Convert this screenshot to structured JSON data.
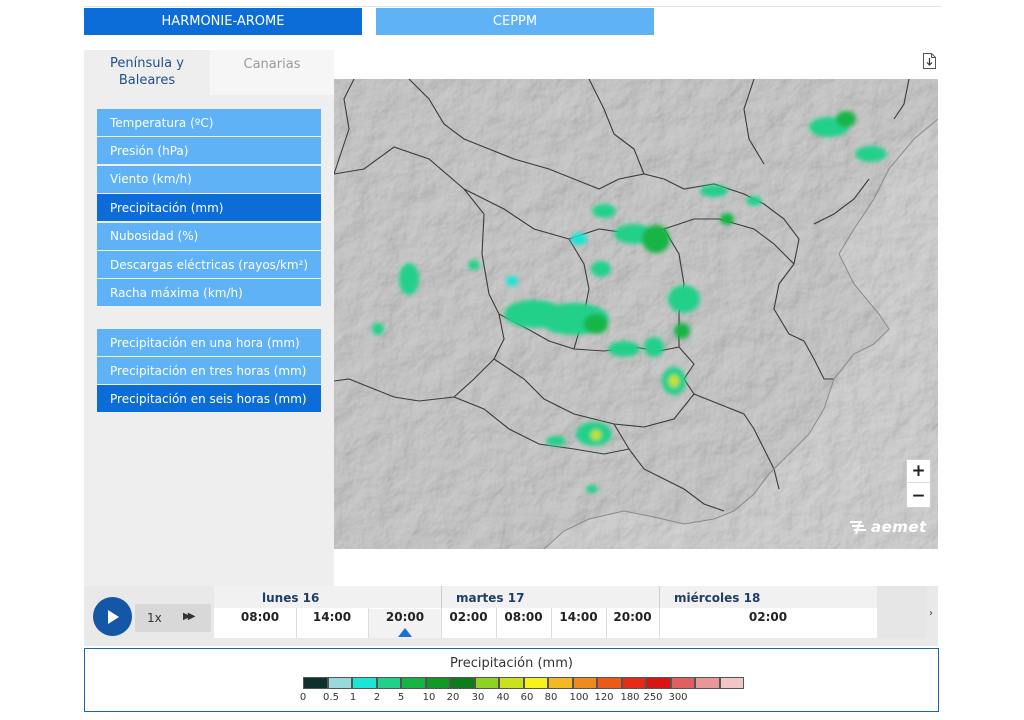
{
  "models": {
    "harmonie": "HARMONIE-AROME",
    "ceppm": "CEPPM"
  },
  "regions": {
    "peninsula": "Península y Baleares",
    "canarias": "Canarias"
  },
  "variables": [
    {
      "label": "Temperatura (ºC)",
      "active": false
    },
    {
      "label": "Presión (hPa)",
      "active": false
    },
    {
      "label": "Viento (km/h)",
      "active": false
    },
    {
      "label": "Precipitación (mm)",
      "active": true
    },
    {
      "label": "Nubosidad (%)",
      "active": false
    },
    {
      "label": "Descargas eléctricas (rayos/km²)",
      "active": false
    },
    {
      "label": "Racha máxima (km/h)",
      "active": false
    }
  ],
  "precip_options": [
    {
      "label": "Precipitación en una hora (mm)",
      "active": false
    },
    {
      "label": "Precipitación en tres horas (mm)",
      "active": false
    },
    {
      "label": "Precipitación en seis horas (mm)",
      "active": true
    }
  ],
  "map": {
    "zoom_in": "+",
    "zoom_out": "−",
    "logo": "aemet"
  },
  "timebar": {
    "speed": "1x",
    "left_arrow": "‹",
    "right_arrow": "›",
    "days": [
      "lunes 16",
      "martes 17",
      "miércoles 18"
    ],
    "hours": [
      "08:00",
      "14:00",
      "20:00",
      "02:00",
      "08:00",
      "14:00",
      "20:00",
      "02:00"
    ],
    "selected_hour_index": 2
  },
  "legend": {
    "title": "Precipitación (mm)",
    "colors": [
      "#10302c",
      "#9ad8e0",
      "#19e6d4",
      "#21d08a",
      "#14b545",
      "#109a25",
      "#0d7c1c",
      "#8fd21f",
      "#c9e21a",
      "#f6f21a",
      "#f4b820",
      "#f08a1c",
      "#ee5a15",
      "#e72a14",
      "#d81414",
      "#e06060",
      "#e89696",
      "#f1c6c6"
    ],
    "labels": [
      "0",
      "0.5",
      "1",
      "2",
      "5",
      "10",
      "20",
      "30",
      "40",
      "60",
      "80",
      "100",
      "120",
      "180",
      "250",
      "300"
    ]
  }
}
